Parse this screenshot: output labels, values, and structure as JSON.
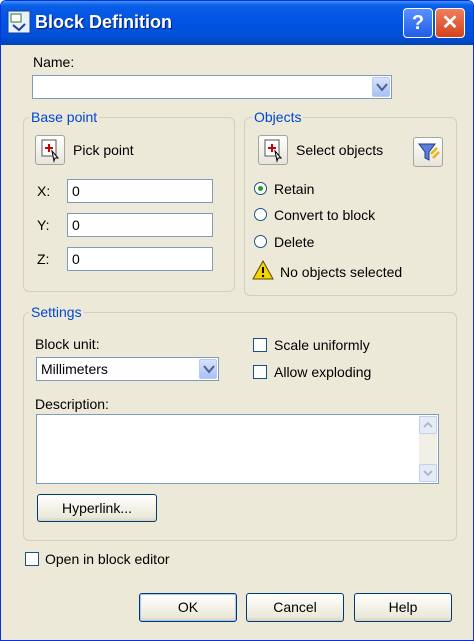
{
  "window": {
    "title": "Block Definition",
    "help_glyph": "?",
    "close_glyph": "✕"
  },
  "name": {
    "label": "Name:",
    "value": ""
  },
  "base_point": {
    "title": "Base point",
    "pick_label": "Pick point",
    "x_label": "X:",
    "x_value": "0",
    "y_label": "Y:",
    "y_value": "0",
    "z_label": "Z:",
    "z_value": "0"
  },
  "objects": {
    "title": "Objects",
    "select_label": "Select objects",
    "options": [
      "Retain",
      "Convert to block",
      "Delete"
    ],
    "selected_option": "Retain",
    "status": "No objects selected"
  },
  "settings": {
    "title": "Settings",
    "block_unit_label": "Block unit:",
    "block_unit_value": "Millimeters",
    "scale_uniformly_label": "Scale uniformly",
    "scale_uniformly_checked": false,
    "allow_exploding_label": "Allow exploding",
    "allow_exploding_checked": false,
    "description_label": "Description:",
    "description_value": "",
    "hyperlink_label": "Hyperlink..."
  },
  "open_in_editor": {
    "label": "Open in block editor",
    "checked": false
  },
  "buttons": {
    "ok": "OK",
    "cancel": "Cancel",
    "help": "Help"
  },
  "colors": {
    "title_bar": "#0054e3",
    "group_title": "#0046d5",
    "dialog_bg": "#ece9d8",
    "radio_dot": "#21a121"
  },
  "icons": [
    "block-definition-icon",
    "help-icon",
    "close-icon",
    "pick-point-icon",
    "select-objects-icon",
    "quick-select-icon",
    "warning-icon",
    "chevron-down-icon",
    "scroll-up-icon",
    "scroll-down-icon"
  ]
}
